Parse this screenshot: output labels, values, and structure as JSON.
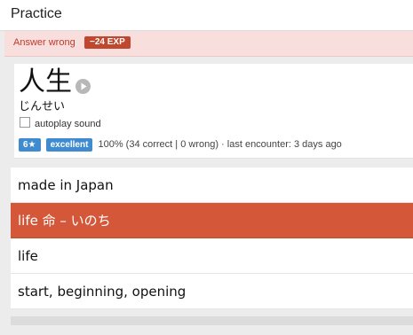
{
  "header": {
    "title": "Practice"
  },
  "alert": {
    "text": "Answer wrong",
    "exp_badge": "−24 EXP"
  },
  "card": {
    "word": "人生",
    "reading": "じんせい",
    "autoplay_label": "autoplay sound",
    "autoplay_checked": false,
    "level_badge": "6★",
    "quality_badge": "excellent",
    "stats_text": "100% (34 correct | 0 wrong)  ·  last encounter: 3 days ago"
  },
  "answers": [
    {
      "label": "made in Japan",
      "state": "normal"
    },
    {
      "label": "life  命 – いのち",
      "state": "wrong"
    },
    {
      "label": "life",
      "state": "normal"
    },
    {
      "label": "start, beginning, opening",
      "state": "normal"
    }
  ],
  "colors": {
    "alert_bg": "#f9dede",
    "alert_text": "#c0392b",
    "wrong_answer": "#d4573a",
    "badge_blue": "#3f8bd0"
  }
}
